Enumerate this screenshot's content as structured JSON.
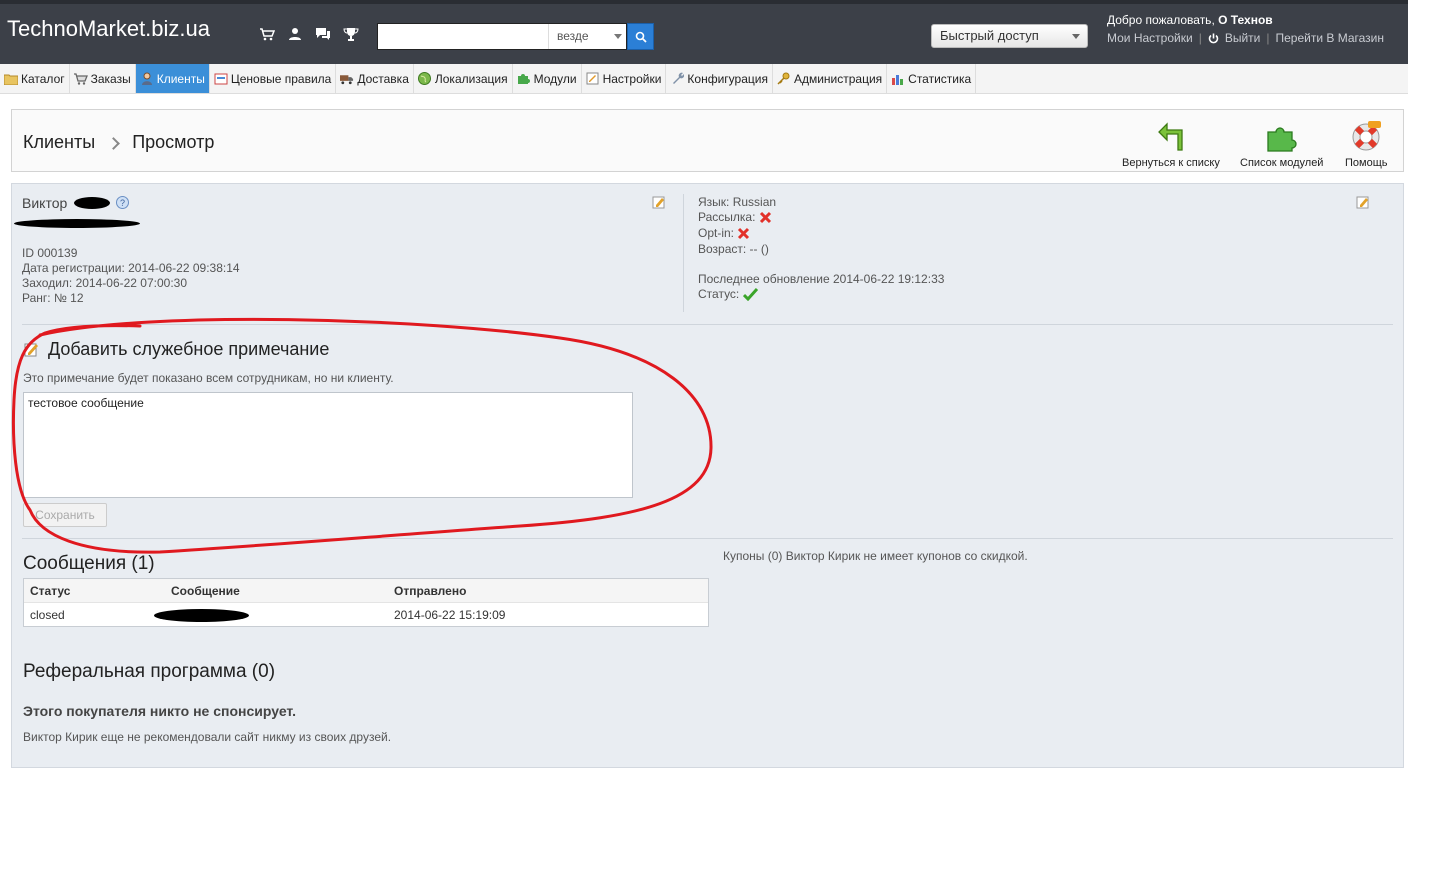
{
  "header": {
    "logo": "TechnoMarket.biz.ua",
    "icons": [
      "cart-icon",
      "users-icon",
      "chat-icon",
      "trophy-icon"
    ],
    "search": {
      "value": "",
      "scope": "везде"
    },
    "quick_access": "Быстрый доступ",
    "welcome_prefix": "Добро пожаловать,",
    "welcome_name": "О Технов",
    "links": {
      "settings": "Мои Настройки",
      "logout": "Выйти",
      "store": "Перейти В Магазин"
    }
  },
  "menu": [
    {
      "label": "Каталог",
      "icon": "folder-icon"
    },
    {
      "label": "Заказы",
      "icon": "cart-icon"
    },
    {
      "label": "Клиенты",
      "icon": "user-icon",
      "active": true
    },
    {
      "label": "Ценовые правила",
      "icon": "price-rules-icon"
    },
    {
      "label": "Доставка",
      "icon": "truck-icon"
    },
    {
      "label": "Локализация",
      "icon": "globe-icon"
    },
    {
      "label": "Модули",
      "icon": "puzzle-icon"
    },
    {
      "label": "Настройки",
      "icon": "settings-icon"
    },
    {
      "label": "Конфигурация",
      "icon": "wrench-icon"
    },
    {
      "label": "Администрация",
      "icon": "key-icon"
    },
    {
      "label": "Статистика",
      "icon": "chart-icon"
    }
  ],
  "breadcrumb": {
    "section": "Клиенты",
    "page": "Просмотр"
  },
  "actions": {
    "back": "Вернуться к списку",
    "modules": "Список модулей",
    "help": "Помощь"
  },
  "customer": {
    "first_name": "Виктор",
    "id": "ID 000139",
    "registered": "Дата регистрации: 2014-06-22 09:38:14",
    "last_visit": "Заходил: 2014-06-22 07:00:30",
    "rank": "Ранг: № 12",
    "language": "Язык: Russian",
    "newsletter_label": "Рассылка:",
    "optin_label": "Opt-in:",
    "age": "Возраст: -- ()",
    "last_update": "Последнее обновление 2014-06-22 19:12:33",
    "status_label": "Статус:"
  },
  "note": {
    "title": "Добавить служебное примечание",
    "hint": "Это примечание будет показано всем сотрудникам, но ни клиенту.",
    "text": "тестовое сообщение",
    "save": "Сохранить"
  },
  "messages": {
    "title": "Сообщения (1)",
    "columns": [
      "Статус",
      "Сообщение",
      "Отправлено"
    ],
    "rows": [
      {
        "status": "closed",
        "sent": "2014-06-22 15:19:09"
      }
    ]
  },
  "coupons": "Купоны (0) Виктор Кирик не имеет купонов со скидкой.",
  "referral": {
    "title": "Реферальная программа (0)",
    "sponsor": "Этого покупателя никто не спонсирует.",
    "friends": "Виктор Кирик еще не рекомендовали сайт никму из своих друзей."
  },
  "colors": {
    "topbar": "#3c4048",
    "accent": "#3b8fd8",
    "annotation": "#e0191f",
    "panel": "#e9edf2"
  }
}
